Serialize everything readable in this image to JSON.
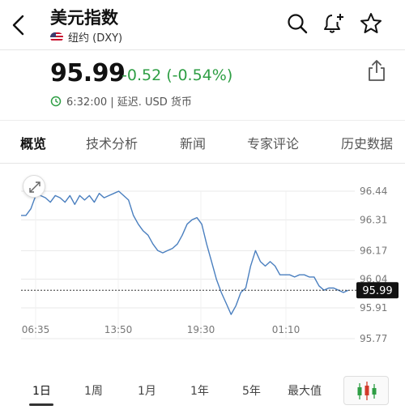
{
  "header": {
    "title": "美元指数",
    "subtitle": "纽约 (DXY)",
    "icons": [
      "back-arrow-icon",
      "us-flag-icon",
      "search-icon",
      "add-alert-bell-icon",
      "star-icon"
    ]
  },
  "quote": {
    "price": "95.99",
    "change": "-0.52 (-0.54%)",
    "change_color": "#2e9e44",
    "meta": "6:32:00 | 延迟. USD 货币"
  },
  "tabs": [
    {
      "label": "概览",
      "active": true
    },
    {
      "label": "技术分析",
      "active": false
    },
    {
      "label": "新闻",
      "active": false
    },
    {
      "label": "专家评论",
      "active": false
    },
    {
      "label": "历史数据",
      "active": false
    }
  ],
  "chart_data": {
    "type": "line",
    "x_tick_labels": [
      "06:35",
      "13:50",
      "19:30",
      "01:10"
    ],
    "y_tick_labels": [
      "96.44",
      "96.31",
      "96.17",
      "96.04",
      "95.91",
      "95.77"
    ],
    "ylim": [
      95.77,
      96.44
    ],
    "current_value": 95.99,
    "current_value_label": "95.99",
    "line_color": "#4a7fbf",
    "grid": true,
    "series": [
      {
        "values": [
          96.33,
          96.33,
          96.36,
          96.42,
          96.42,
          96.41,
          96.39,
          96.42,
          96.41,
          96.39,
          96.42,
          96.38,
          96.42,
          96.4,
          96.42,
          96.39,
          96.43,
          96.41,
          96.42,
          96.43,
          96.44,
          96.42,
          96.4,
          96.33,
          96.29,
          96.26,
          96.24,
          96.2,
          96.17,
          96.16,
          96.17,
          96.18,
          96.2,
          96.24,
          96.29,
          96.31,
          96.32,
          96.29,
          96.2,
          96.12,
          96.04,
          95.98,
          95.93,
          95.88,
          95.92,
          95.98,
          96.0,
          96.1,
          96.17,
          96.12,
          96.1,
          96.12,
          96.1,
          96.06,
          96.06,
          96.06,
          96.05,
          96.06,
          96.06,
          96.05,
          96.05,
          96.01,
          95.99,
          96.0,
          96.0,
          95.99,
          95.98,
          95.99
        ]
      }
    ]
  },
  "ranges": [
    {
      "label": "1日",
      "active": true
    },
    {
      "label": "1周",
      "active": false
    },
    {
      "label": "1月",
      "active": false
    },
    {
      "label": "1年",
      "active": false
    },
    {
      "label": "5年",
      "active": false
    },
    {
      "label": "最大值",
      "active": false
    }
  ],
  "candlestick_button_icon": "candlestick-chart-icon"
}
